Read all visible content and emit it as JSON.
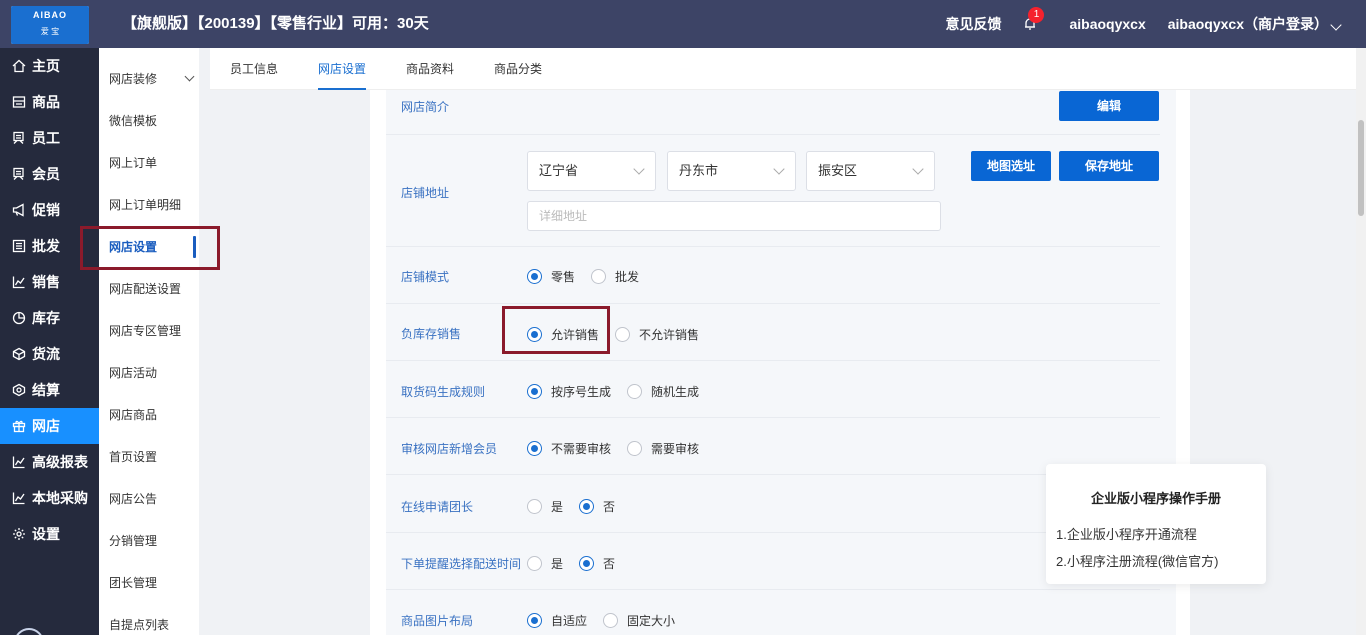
{
  "header": {
    "logo_text": "AIBAO",
    "logo_sub": "爱  宝",
    "title": "【旗舰版】【200139】【零售行业】可用：30天",
    "feedback": "意见反馈",
    "notification_count": "1",
    "user_name": "aibaoqyxcx",
    "user_login": "aibaoqyxcx（商户登录）"
  },
  "sidebar": {
    "items": [
      {
        "label": "主页",
        "icon": "home-icon"
      },
      {
        "label": "商品",
        "icon": "product-icon"
      },
      {
        "label": "员工",
        "icon": "staff-icon"
      },
      {
        "label": "会员",
        "icon": "member-icon"
      },
      {
        "label": "促销",
        "icon": "promotion-icon"
      },
      {
        "label": "批发",
        "icon": "wholesale-icon"
      },
      {
        "label": "销售",
        "icon": "sales-icon"
      },
      {
        "label": "库存",
        "icon": "inventory-icon"
      },
      {
        "label": "货流",
        "icon": "logistics-icon"
      },
      {
        "label": "结算",
        "icon": "settlement-icon"
      },
      {
        "label": "网店",
        "icon": "gift-icon"
      },
      {
        "label": "高级报表",
        "icon": "report-icon"
      },
      {
        "label": "本地采购",
        "icon": "purchase-icon"
      },
      {
        "label": "设置",
        "icon": "settings-icon"
      }
    ],
    "active_index": 10
  },
  "subnav": {
    "items": [
      "网店装修",
      "微信模板",
      "网上订单",
      "网上订单明细",
      "网店设置",
      "网店配送设置",
      "网店专区管理",
      "网店活动",
      "网店商品",
      "首页设置",
      "网店公告",
      "分销管理",
      "团长管理",
      "自提点列表"
    ],
    "active_index": 4
  },
  "tabs": [
    "员工信息",
    "网店设置",
    "商品资料",
    "商品分类"
  ],
  "form": {
    "intro_label": "网店简介",
    "edit_button": "编辑",
    "address_label": "店铺地址",
    "province": "辽宁省",
    "city": "丹东市",
    "district": "振安区",
    "detail_placeholder": "详细地址",
    "map_button": "地图选址",
    "save_address_button": "保存地址",
    "rows": [
      {
        "label": "店铺模式",
        "options": [
          "零售",
          "批发"
        ],
        "selected": 0
      },
      {
        "label": "负库存销售",
        "options": [
          "允许销售",
          "不允许销售"
        ],
        "selected": 0
      },
      {
        "label": "取货码生成规则",
        "options": [
          "按序号生成",
          "随机生成"
        ],
        "selected": 0
      },
      {
        "label": "审核网店新增会员",
        "options": [
          "不需要审核",
          "需要审核"
        ],
        "selected": 0
      },
      {
        "label": "在线申请团长",
        "options": [
          "是",
          "否"
        ],
        "selected": 1
      },
      {
        "label": "下单提醒选择配送时间",
        "options": [
          "是",
          "否"
        ],
        "selected": 1
      },
      {
        "label": "商品图片布局",
        "options": [
          "自适应",
          "固定大小"
        ],
        "selected": 0
      }
    ]
  },
  "help": {
    "title": "企业版小程序操作手册",
    "items": [
      "1.企业版小程序开通流程",
      "2.小程序注册流程(微信官方)"
    ]
  },
  "colors": {
    "topbar": "#3d4466",
    "sidebar": "#252a3d",
    "accent": "#1890ff",
    "button": "#0966d4",
    "highlight": "#8b1a2b"
  }
}
